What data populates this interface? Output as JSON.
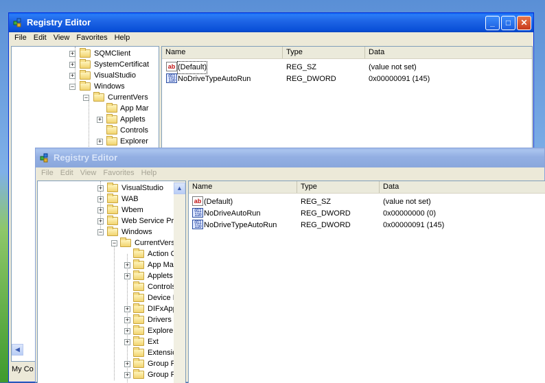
{
  "back_window": {
    "title": "Registry Editor",
    "menu": [
      "File",
      "Edit",
      "View",
      "Favorites",
      "Help"
    ],
    "tree": [
      {
        "label": "SQMClient",
        "expander": "+"
      },
      {
        "label": "SystemCertificat",
        "expander": "+"
      },
      {
        "label": "VisualStudio",
        "expander": "+"
      },
      {
        "label": "Windows",
        "expander": "−"
      },
      {
        "label": "CurrentVers",
        "expander": "−"
      },
      {
        "label": "App Mar",
        "expander": ""
      },
      {
        "label": "Applets",
        "expander": "+"
      },
      {
        "label": "Controls",
        "expander": ""
      },
      {
        "label": "Explorer",
        "expander": "+"
      }
    ],
    "columns": [
      "Name",
      "Type",
      "Data"
    ],
    "values": [
      {
        "name": "(Default)",
        "type": "REG_SZ",
        "data": "(value not set)",
        "icon": "ab-icon"
      },
      {
        "name": "NoDriveTypeAutoRun",
        "type": "REG_DWORD",
        "data": "0x00000091 (145)",
        "icon": "binary-icon"
      }
    ],
    "status": "My Co"
  },
  "front_window": {
    "title": "Registry Editor",
    "menu": [
      "File",
      "Edit",
      "View",
      "Favorites",
      "Help"
    ],
    "tree": [
      {
        "label": "VisualStudio",
        "expander": "+"
      },
      {
        "label": "WAB",
        "expander": "+"
      },
      {
        "label": "Wbem",
        "expander": "+"
      },
      {
        "label": "Web Service Pro",
        "expander": "+"
      },
      {
        "label": "Windows",
        "expander": "−"
      },
      {
        "label": "CurrentVers",
        "expander": "−"
      },
      {
        "label": "Action C",
        "expander": ""
      },
      {
        "label": "App Mar",
        "expander": "+"
      },
      {
        "label": "Applets",
        "expander": "+"
      },
      {
        "label": "Controls",
        "expander": ""
      },
      {
        "label": "Device I",
        "expander": ""
      },
      {
        "label": "DIFxApp",
        "expander": "+"
      },
      {
        "label": "Drivers",
        "expander": "+"
      },
      {
        "label": "Explorer",
        "expander": "+"
      },
      {
        "label": "Ext",
        "expander": "+"
      },
      {
        "label": "Extensio",
        "expander": ""
      },
      {
        "label": "Group P",
        "expander": "+"
      },
      {
        "label": "Group P",
        "expander": "+"
      }
    ],
    "columns": [
      "Name",
      "Type",
      "Data"
    ],
    "values": [
      {
        "name": "(Default)",
        "type": "REG_SZ",
        "data": "(value not set)",
        "icon": "ab-icon"
      },
      {
        "name": "NoDriveAutoRun",
        "type": "REG_DWORD",
        "data": "0x00000000 (0)",
        "icon": "binary-icon"
      },
      {
        "name": "NoDriveTypeAutoRun",
        "type": "REG_DWORD",
        "data": "0x00000091 (145)",
        "icon": "binary-icon"
      }
    ]
  }
}
